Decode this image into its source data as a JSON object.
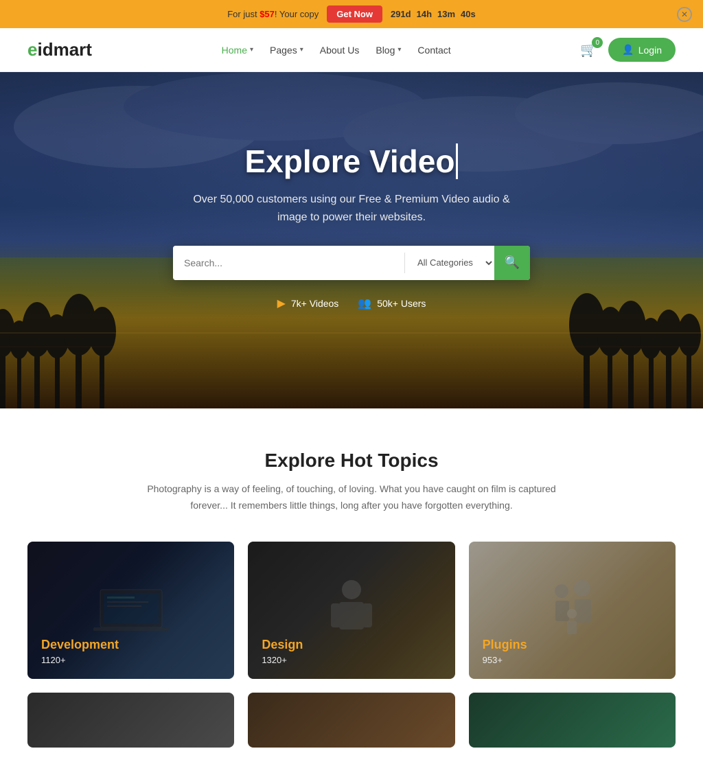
{
  "banner": {
    "text": "For just ",
    "price": "$57",
    "text2": "! Your copy",
    "cta": "Get Now",
    "countdown": {
      "days": "291d",
      "hours": "14h",
      "minutes": "13m",
      "seconds": "40s"
    }
  },
  "header": {
    "logo": {
      "e": "e",
      "rest": "idmart"
    },
    "nav": [
      {
        "label": "Home",
        "hasDropdown": true,
        "active": true
      },
      {
        "label": "Pages",
        "hasDropdown": true,
        "active": false
      },
      {
        "label": "About Us",
        "hasDropdown": false,
        "active": false
      },
      {
        "label": "Blog",
        "hasDropdown": true,
        "active": false
      },
      {
        "label": "Contact",
        "hasDropdown": false,
        "active": false
      }
    ],
    "cartCount": "0",
    "loginLabel": "Login"
  },
  "hero": {
    "title": "Explore Video",
    "subtitle": "Over 50,000 customers using our Free & Premium Video audio & image to power their websites.",
    "search": {
      "placeholder": "Search...",
      "categoryDefault": "All Categories"
    },
    "stats": [
      {
        "icon": "▶",
        "label": "7k+ Videos"
      },
      {
        "icon": "👥",
        "label": "50k+ Users"
      }
    ]
  },
  "topics": {
    "sectionTitle": "Explore Hot Topics",
    "sectionSubtitle": "Photography is a way of feeling, of touching, of loving. What you have caught on film is captured forever... It remembers little things, long after you have forgotten everything.",
    "cards": [
      {
        "label": "Development",
        "count": "1120+"
      },
      {
        "label": "Design",
        "count": "1320+"
      },
      {
        "label": "Plugins",
        "count": "953+"
      }
    ]
  },
  "colors": {
    "green": "#4caf50",
    "orange": "#f5a623",
    "red": "#e53935",
    "dark": "#222222"
  }
}
